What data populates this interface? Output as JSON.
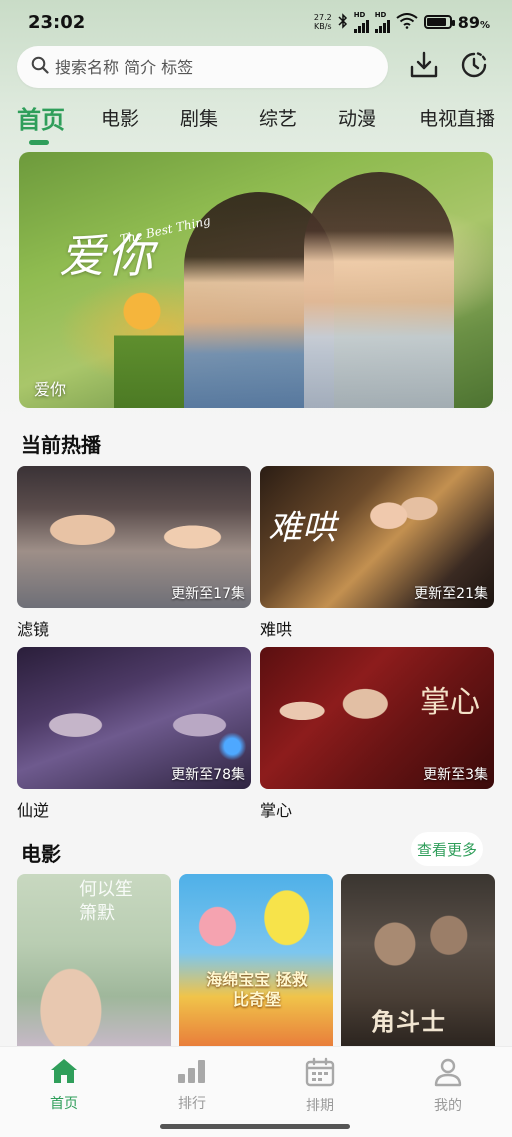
{
  "status_bar": {
    "time": "23:02",
    "net_speed_value": "27.2",
    "net_speed_unit": "KB/s",
    "hd1": "HD",
    "hd2": "HD",
    "battery_percent": "89",
    "battery_unit": "%",
    "battery_level": 0.89
  },
  "search": {
    "placeholder": "搜索名称 简介 标签"
  },
  "header_icons": [
    "download-icon",
    "history-icon"
  ],
  "tabs": [
    {
      "label": "首页",
      "active": true
    },
    {
      "label": "电影",
      "active": false
    },
    {
      "label": "剧集",
      "active": false
    },
    {
      "label": "综艺",
      "active": false
    },
    {
      "label": "动漫",
      "active": false
    },
    {
      "label": "电视直播",
      "active": false
    }
  ],
  "banner": {
    "logo_text": "爱你",
    "logo_subtitle": "The Best Thing",
    "caption": "爱你"
  },
  "hot": {
    "title": "当前热播",
    "items": [
      {
        "title": "滤镜",
        "badge": "更新至17集"
      },
      {
        "title": "难哄",
        "badge": "更新至21集",
        "poster_text": "难哄"
      },
      {
        "title": "仙逆",
        "badge": "更新至78集"
      },
      {
        "title": "掌心",
        "badge": "更新至3集",
        "poster_text": "掌心"
      }
    ]
  },
  "movies": {
    "title": "电影",
    "more_label": "查看更多",
    "posters": [
      {
        "text": "何以笙箫默"
      },
      {
        "text": "海绵宝宝 拯救比奇堡"
      },
      {
        "text": "角斗士"
      }
    ]
  },
  "bottom_nav": [
    {
      "label": "首页",
      "icon": "home-icon",
      "active": true
    },
    {
      "label": "排行",
      "icon": "ranking-icon",
      "active": false
    },
    {
      "label": "排期",
      "icon": "calendar-icon",
      "active": false
    },
    {
      "label": "我的",
      "icon": "profile-icon",
      "active": false
    }
  ],
  "colors": {
    "accent": "#2f9e5a",
    "inactive_nav": "#9a9a9a",
    "background": "#f5f5f5"
  }
}
